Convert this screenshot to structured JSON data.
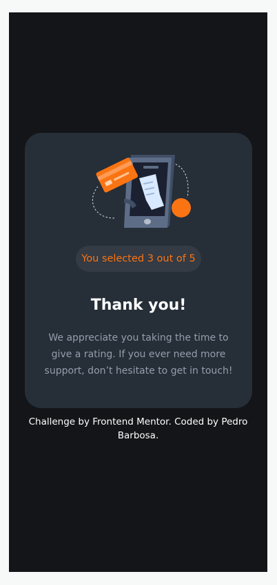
{
  "card": {
    "selection_text": "You selected 3 out of 5",
    "title": "Thank you!",
    "message": "We appreciate you taking the time to give a rating. If you ever need more support, don’t hesitate to get in touch!"
  },
  "attribution": {
    "text": "Challenge by Frontend Mentor. Coded by Pedro Barbosa."
  },
  "colors": {
    "page_background": "#131518",
    "card_background": "#262e38",
    "accent": "#fb7413",
    "muted_text": "#959eac",
    "pill_background": "#343b44"
  },
  "icons": {
    "illustration": "thank-you-illustration"
  }
}
